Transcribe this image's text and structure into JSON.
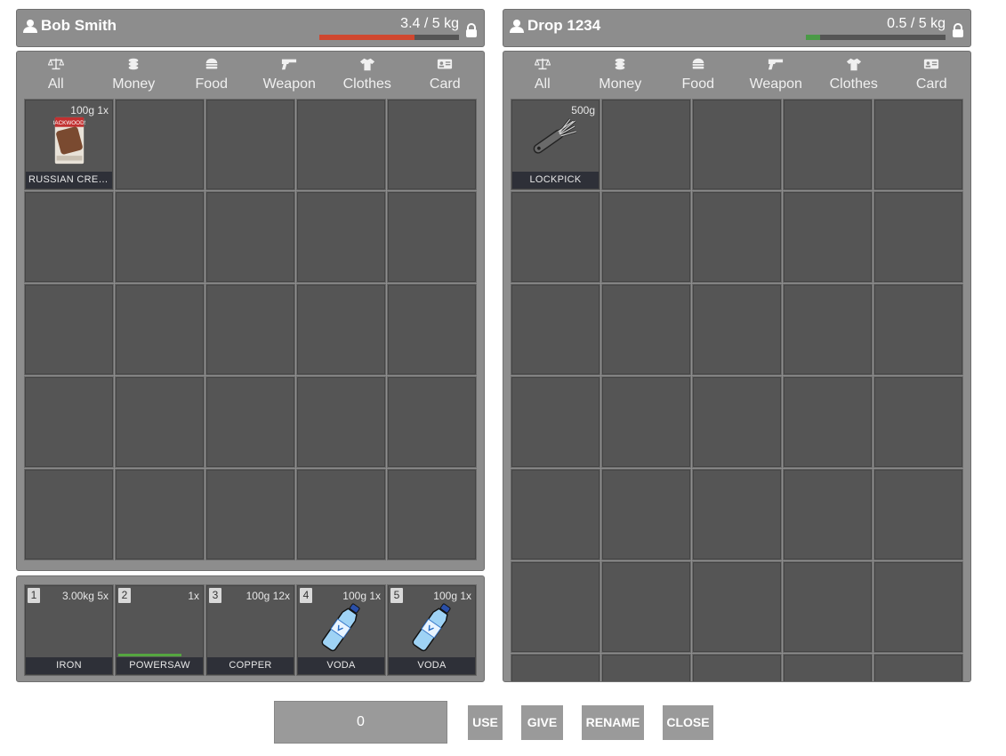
{
  "left": {
    "owner": "Bob Smith",
    "weight": "3.4 / 5 kg",
    "weight_fraction": 0.68,
    "bar_color": "#d0472f",
    "tabs": [
      {
        "label": "All",
        "icon": "scale-icon"
      },
      {
        "label": "Money",
        "icon": "coins-icon"
      },
      {
        "label": "Food",
        "icon": "burger-icon"
      },
      {
        "label": "Weapon",
        "icon": "gun-icon"
      },
      {
        "label": "Clothes",
        "icon": "shirt-icon"
      },
      {
        "label": "Card",
        "icon": "id-card-icon"
      }
    ],
    "items": [
      {
        "slot": 0,
        "meta": "100g 1x",
        "label": "RUSSIAN CREA...",
        "icon": "cigar-pack-icon"
      }
    ],
    "hotbar": [
      {
        "num": "1",
        "meta": "3.00kg 5x",
        "label": "IRON",
        "icon": ""
      },
      {
        "num": "2",
        "meta": "1x",
        "label": "POWERSAW",
        "icon": "",
        "durability": 0.75
      },
      {
        "num": "3",
        "meta": "100g 12x",
        "label": "COPPER",
        "icon": ""
      },
      {
        "num": "4",
        "meta": "100g 1x",
        "label": "VODA",
        "icon": "water-bottle-icon"
      },
      {
        "num": "5",
        "meta": "100g 1x",
        "label": "VODA",
        "icon": "water-bottle-icon"
      }
    ]
  },
  "right": {
    "owner": "Drop 1234",
    "weight": "0.5 / 5 kg",
    "weight_fraction": 0.1,
    "bar_color": "#4a9a46",
    "tabs": [
      {
        "label": "All",
        "icon": "scale-icon"
      },
      {
        "label": "Money",
        "icon": "coins-icon"
      },
      {
        "label": "Food",
        "icon": "burger-icon"
      },
      {
        "label": "Weapon",
        "icon": "gun-icon"
      },
      {
        "label": "Clothes",
        "icon": "shirt-icon"
      },
      {
        "label": "Card",
        "icon": "id-card-icon"
      }
    ],
    "items": [
      {
        "slot": 0,
        "meta": "500g",
        "label": "LOCKPICK",
        "icon": "lockpick-icon"
      }
    ]
  },
  "footer": {
    "amount": "0",
    "use_label": "USE",
    "give_label": "GIVE",
    "rename_label": "RENAME",
    "close_label": "CLOSE"
  }
}
